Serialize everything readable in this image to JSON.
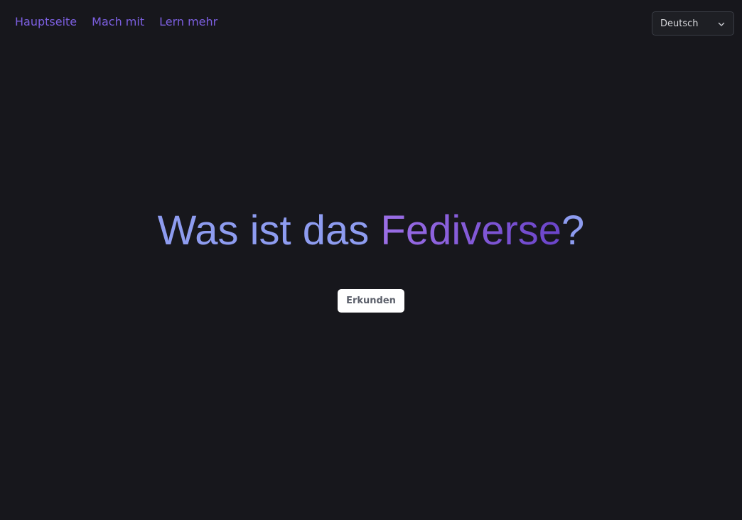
{
  "nav": {
    "links": [
      {
        "label": "Hauptseite"
      },
      {
        "label": "Mach mit"
      },
      {
        "label": "Lern mehr"
      }
    ]
  },
  "language": {
    "selected": "Deutsch",
    "icon": "chevron-down-icon"
  },
  "hero": {
    "title_prefix": "Was ist das ",
    "title_highlight": "Fediverse",
    "title_suffix": "?",
    "cta_label": "Erkunden"
  },
  "colors": {
    "background": "#17171c",
    "nav_link": "#7c5fe0",
    "title_primary": "#8e9cf0",
    "title_highlight_start": "#9c6fe6",
    "title_highlight_end": "#6a44c9",
    "button_bg": "#ffffff",
    "button_text": "#5b5f6a"
  }
}
